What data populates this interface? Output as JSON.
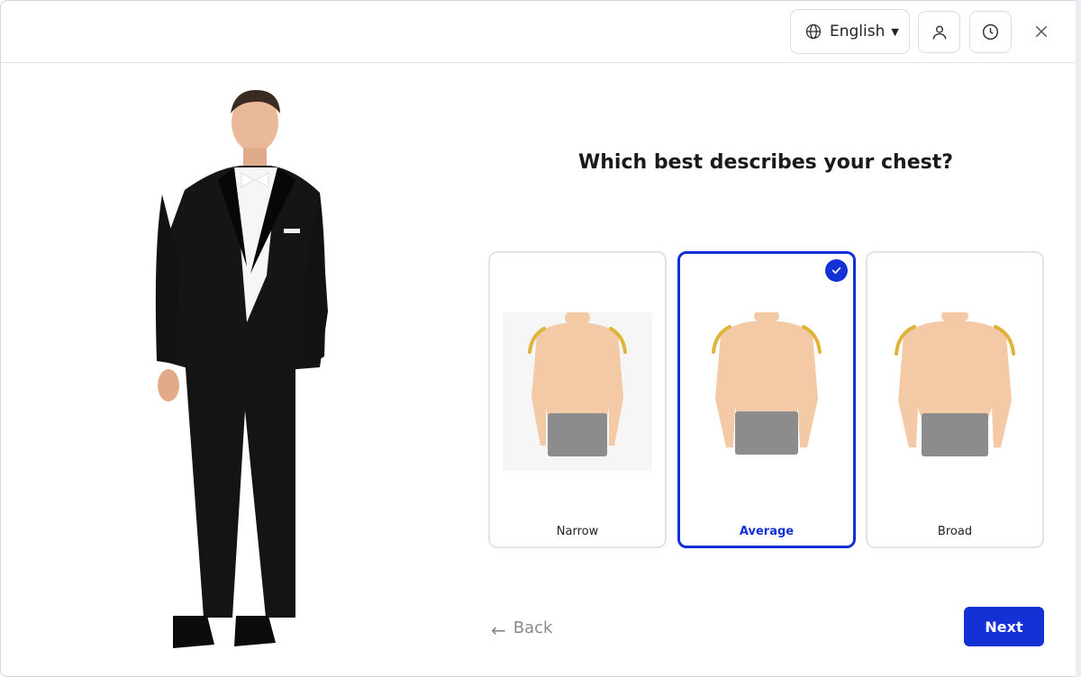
{
  "header": {
    "language": {
      "label": "English",
      "icon": "globe-icon",
      "caret_icon": "caret-down-icon"
    },
    "profile_icon": "user-icon",
    "history_icon": "clock-icon",
    "close_icon": "close-icon"
  },
  "question": "Which best describes your chest?",
  "options": [
    {
      "label": "Narrow",
      "selected": false,
      "body_shape": "narrow"
    },
    {
      "label": "Average",
      "selected": true,
      "body_shape": "average"
    },
    {
      "label": "Broad",
      "selected": false,
      "body_shape": "broad"
    }
  ],
  "navigation": {
    "back_label": "Back",
    "back_icon": "arrow-left-icon",
    "next_label": "Next"
  },
  "colors": {
    "accent": "#1431d6",
    "shoulder_highlight": "#e0b43a",
    "skin": "#f3c9a6",
    "underwear": "#8c8c8c",
    "suit": "#141414"
  }
}
